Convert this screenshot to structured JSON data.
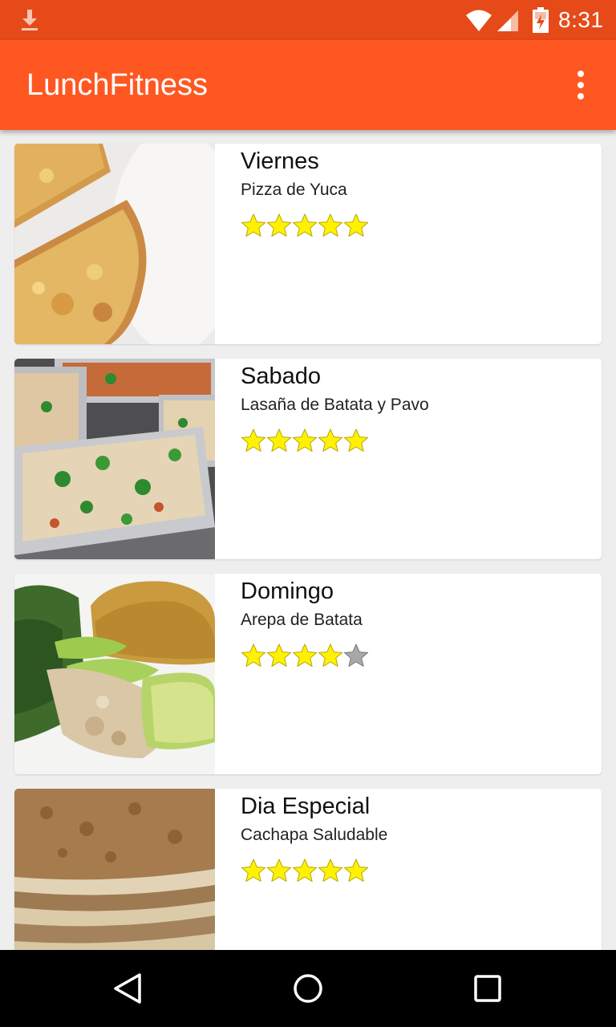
{
  "status_bar": {
    "time": "8:31",
    "icons": [
      "download-icon",
      "wifi-icon",
      "signal-icon",
      "battery-icon"
    ]
  },
  "app_bar": {
    "title": "LunchFitness",
    "menu_icon": "overflow-menu-icon"
  },
  "colors": {
    "status_bar": "#E64A19",
    "app_bar": "#FF5722",
    "star_filled": "#FFF200",
    "star_empty": "#A8A8A8",
    "background": "#EEEEEE"
  },
  "items": [
    {
      "day": "Viernes",
      "dish": "Pizza de Yuca",
      "rating": 5,
      "max_rating": 5,
      "image": "pizza-photo"
    },
    {
      "day": "Sabado",
      "dish": "Lasaña de Batata y Pavo",
      "rating": 5,
      "max_rating": 5,
      "image": "lasagna-photo"
    },
    {
      "day": "Domingo",
      "dish": "Arepa de Batata",
      "rating": 4,
      "max_rating": 5,
      "image": "arepa-photo"
    },
    {
      "day": "Dia Especial",
      "dish": "Cachapa Saludable",
      "rating": 5,
      "max_rating": 5,
      "image": "pancakes-photo"
    }
  ],
  "nav_bar": {
    "buttons": [
      "back-icon",
      "home-icon",
      "recents-icon"
    ]
  }
}
